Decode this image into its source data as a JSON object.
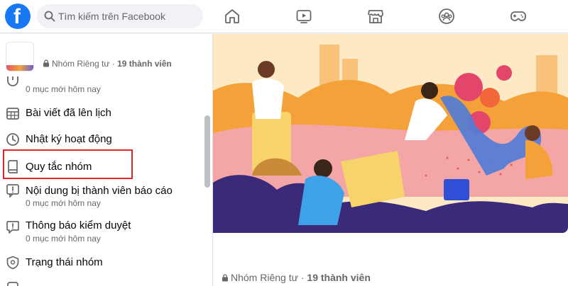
{
  "search": {
    "placeholder": "Tìm kiếm trên Facebook"
  },
  "logo": {
    "letter": "f"
  },
  "nav": {
    "icons": [
      "home-icon",
      "watch-icon",
      "marketplace-icon",
      "groups-icon",
      "gaming-icon"
    ]
  },
  "group": {
    "privacy": "Nhóm Riêng tư",
    "separator": " · ",
    "members": "19 thành viên"
  },
  "sidebar": {
    "items": [
      {
        "label": "",
        "sub": "0 mục mới hôm nay",
        "icon": "pending-icon"
      },
      {
        "label": "Bài viết đã lên lịch",
        "sub": "",
        "icon": "calendar-icon"
      },
      {
        "label": "Nhật ký hoạt động",
        "sub": "",
        "icon": "clock-icon"
      },
      {
        "label": "Quy tắc nhóm",
        "sub": "",
        "icon": "rules-book-icon"
      },
      {
        "label": "Nội dung bị thành viên báo cáo",
        "sub": "0 mục mới hôm nay",
        "icon": "report-icon"
      },
      {
        "label": "Thông báo kiểm duyệt",
        "sub": "0 mục mới hôm nay",
        "icon": "moderation-alert-icon"
      },
      {
        "label": "Trạng thái nhóm",
        "sub": "",
        "icon": "shield-icon"
      }
    ]
  },
  "main": {
    "privacy": "Nhóm Riêng tư",
    "separator": " · ",
    "members": "19 thành viên"
  },
  "colors": {
    "brand": "#1877f2",
    "highlight": "#e02424",
    "icon": "#65676b"
  }
}
